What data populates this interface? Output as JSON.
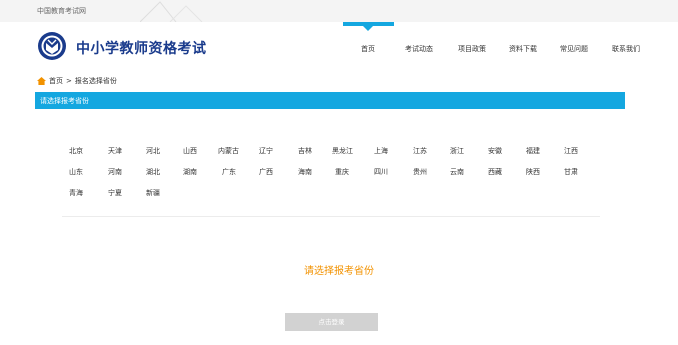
{
  "top": {
    "site_name": "中国教育考试网"
  },
  "header": {
    "title": "中小学教师资格考试"
  },
  "nav": [
    "首页",
    "考试动态",
    "项目政策",
    "资料下载",
    "常见问题",
    "联系我们"
  ],
  "breadcrumb": {
    "home": "首页",
    "separator": ">",
    "current": "报名选择省份"
  },
  "section_title": "请选择报考省份",
  "provinces": [
    "北京",
    "天津",
    "河北",
    "山西",
    "内蒙古",
    "辽宁",
    "吉林",
    "黑龙江",
    "上海",
    "江苏",
    "浙江",
    "安徽",
    "福建",
    "江西",
    "山东",
    "河南",
    "湖北",
    "湖南",
    "广东",
    "广西",
    "海南",
    "重庆",
    "四川",
    "贵州",
    "云南",
    "西藏",
    "陕西",
    "甘肃",
    "青海",
    "宁夏",
    "新疆"
  ],
  "prompt": "请选择报考省份",
  "login_button": "点击登录",
  "colors": {
    "accent": "#14a7e0",
    "brand": "#1a3b8c",
    "prompt": "#f29200"
  },
  "icons": {
    "home": "home-icon",
    "logo": "logo-icon"
  }
}
